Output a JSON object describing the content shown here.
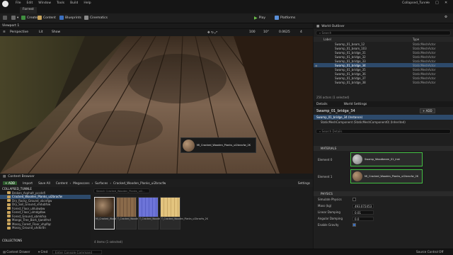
{
  "menubar": {
    "items": [
      "File",
      "Edit",
      "Window",
      "Tools",
      "Build",
      "Help"
    ],
    "project_name": "Collapsed_Tunnle",
    "level_tab": "Forrest"
  },
  "toolbar": {
    "create": "Create",
    "content": "Content",
    "blueprints": "Blueprints",
    "cinematics": "Cinematics",
    "play": "Play",
    "platforms": "Platforms"
  },
  "viewport": {
    "tab": "Viewport 1",
    "perspective": "Perspective",
    "lit": "Lit",
    "show": "Show",
    "grid_snap": "100",
    "rot_snap": "10°",
    "scale_snap": "0.0625",
    "cam_speed": "4",
    "tooltip": "MI_Cracked_Wooden_Planks_ui2bracfw_2K"
  },
  "outliner": {
    "tab": "World Outliner",
    "search_placeholder": "Search",
    "col_label": "Label",
    "col_type": "Type",
    "rows": [
      {
        "label": "Swamp_01_beam_12",
        "type": "StaticMeshActor",
        "selected": false
      },
      {
        "label": "Swamp_01_beam_103",
        "type": "StaticMeshActor",
        "selected": false
      },
      {
        "label": "Swamp_01_bridge_31",
        "type": "StaticMeshActor",
        "selected": false
      },
      {
        "label": "Swamp_01_bridge_32",
        "type": "StaticMeshActor",
        "selected": false
      },
      {
        "label": "Swamp_01_bridge_33",
        "type": "StaticMeshActor",
        "selected": false
      },
      {
        "label": "Swamp_01_bridge_34",
        "type": "StaticMeshActor",
        "selected": true
      },
      {
        "label": "Swamp_01_bridge_35",
        "type": "StaticMeshActor",
        "selected": false
      },
      {
        "label": "Swamp_01_bridge_36",
        "type": "StaticMeshActor",
        "selected": false
      },
      {
        "label": "Swamp_01_bridge_37",
        "type": "StaticMeshActor",
        "selected": false
      },
      {
        "label": "Swamp_01_bridge_38",
        "type": "StaticMeshActor",
        "selected": false
      }
    ],
    "footer": "256 actors (1 selected)"
  },
  "details": {
    "tab": "Details",
    "tab2": "World Settings",
    "actor_name": "Swamp_01_bridge_34",
    "add_label": "+ ADD",
    "instance": "Swamp_01_bridge_34 (Instance)",
    "component": "StaticMeshComponent (StaticMeshComponent0) (Inherited)",
    "search_placeholder": "Search Details",
    "materials_header": "MATERIALS",
    "element0_label": "Element 0",
    "element0_value": "Swamp_Woodbeam_01_inst",
    "element1_label": "Element 1",
    "element1_value": "MI_Cracked_Wooden_Planks_ui2bracfw_2K",
    "physics_header": "PHYSICS",
    "physics_props": [
      {
        "label": "Simulate Physics",
        "value": ""
      },
      {
        "label": "Mass (kg)",
        "value": "493.072453"
      },
      {
        "label": "Linear Damping",
        "value": "0.01"
      },
      {
        "label": "Angular Damping",
        "value": "0.0"
      },
      {
        "label": "Enable Gravity",
        "value": ""
      }
    ]
  },
  "content_browser": {
    "tab": "Content Browser",
    "add": "+ ADD",
    "import": "Import",
    "save_all": "Save All",
    "path": [
      "Content",
      "Megascans",
      "Surfaces",
      "Cracked_Wooden_Planks_ui2bracfw"
    ],
    "settings": "Settings",
    "search_placeholder": "Search Cracked_Wooden_Planks_ui2...",
    "tree_root": "COLLAPSED_TUNNLE",
    "tree": [
      {
        "label": "Broken_Asphalt_pccdsfi",
        "selected": false
      },
      {
        "label": "Cracked_Wooden_Planks_ui2bracfw",
        "selected": true
      },
      {
        "label": "Dry_Rocky_Ground_vbcnfgw",
        "selected": false
      },
      {
        "label": "Dry_Soil_Ground_vhdubfsw",
        "selected": false
      },
      {
        "label": "Forest_Floor_uhlukwbw",
        "selected": false
      },
      {
        "label": "Forest_Floor_ulmdgdbw",
        "selected": false
      },
      {
        "label": "Forest_Ground_ubmkfxa",
        "selected": false
      },
      {
        "label": "Mango_Tree_Bark_tjankfmd",
        "selected": false
      },
      {
        "label": "Mossy_Forest_Floor_vhplfqc",
        "selected": false
      },
      {
        "label": "Mossy_Ground_uhdkr0n",
        "selected": false
      }
    ],
    "collections": "COLLECTIONS",
    "assets": [
      {
        "label": "MI_Cracked_Wooden_Planks_ui2...",
        "color": "#7b5c3e"
      },
      {
        "label": "T_Cracked_Wooden_Planks_ui2...",
        "color": "#8a6a4a"
      },
      {
        "label": "T_Cracked_Wooden_Planks_ui2...",
        "color": "#6d74d8"
      },
      {
        "label": "T_Cracked_Wooden_Planks_ui2bracfw_2K",
        "color": "#e3c47e"
      }
    ],
    "item_count": "4 items (1 selected)"
  },
  "status": {
    "content_drawer": "Content Drawer",
    "cmd": "Cmd",
    "console_placeholder": "Enter Console Command",
    "source_control": "Source Control Off"
  }
}
